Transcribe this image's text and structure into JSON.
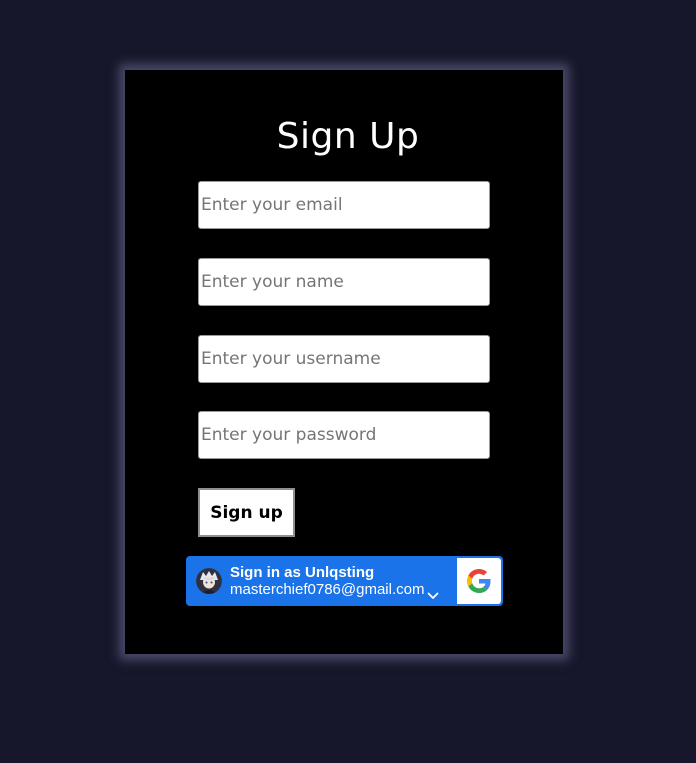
{
  "signup_form": {
    "title": "Sign Up",
    "email_placeholder": "Enter your email",
    "name_placeholder": "Enter your name",
    "username_placeholder": "Enter your username",
    "password_placeholder": "Enter your password",
    "submit_label": "Sign up"
  },
  "google_signin": {
    "title": "Sign in as Unlqsting",
    "email": "masterchief0786@gmail.com",
    "avatar_icon": "user-avatar-icon",
    "dropdown_icon": "chevron-down-icon",
    "logo_icon": "google-logo-icon",
    "button_color": "#1a73e8"
  },
  "colors": {
    "page_background": "#16172a",
    "card_background": "#000000",
    "card_glow": "#5c5c80"
  }
}
